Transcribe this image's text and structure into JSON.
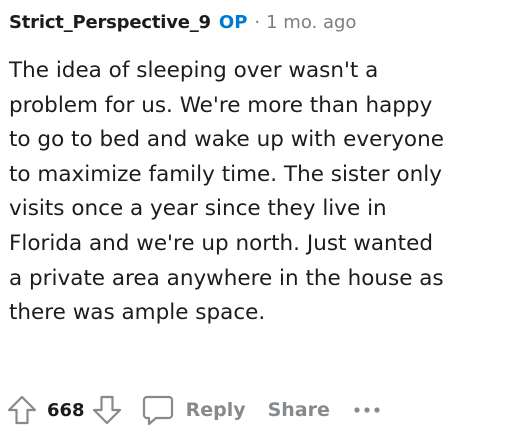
{
  "comment": {
    "author": "Strict_Perspective_9",
    "op_badge": "OP",
    "separator": "·",
    "timestamp": "1 mo. ago",
    "body_lines": [
      "The idea of sleeping over wasn't a",
      "problem for us. We're more than happy",
      "to go to bed and wake up with everyone",
      "to maximize family time. The sister only",
      "visits once a year since they live in",
      "Florida and we're up north. Just wanted",
      "a private area anywhere in the house as",
      "there was ample space."
    ]
  },
  "actions": {
    "upvote_icon": "upvote-arrow-icon",
    "vote_count": "668",
    "downvote_icon": "downvote-arrow-icon",
    "reply_icon": "comment-bubble-icon",
    "reply_label": "Reply",
    "share_label": "Share",
    "more_icon": "more-options-icon"
  },
  "colors": {
    "op_badge": "#0079d3",
    "muted_text": "#878a8c",
    "body_text": "#1c1c1c"
  }
}
